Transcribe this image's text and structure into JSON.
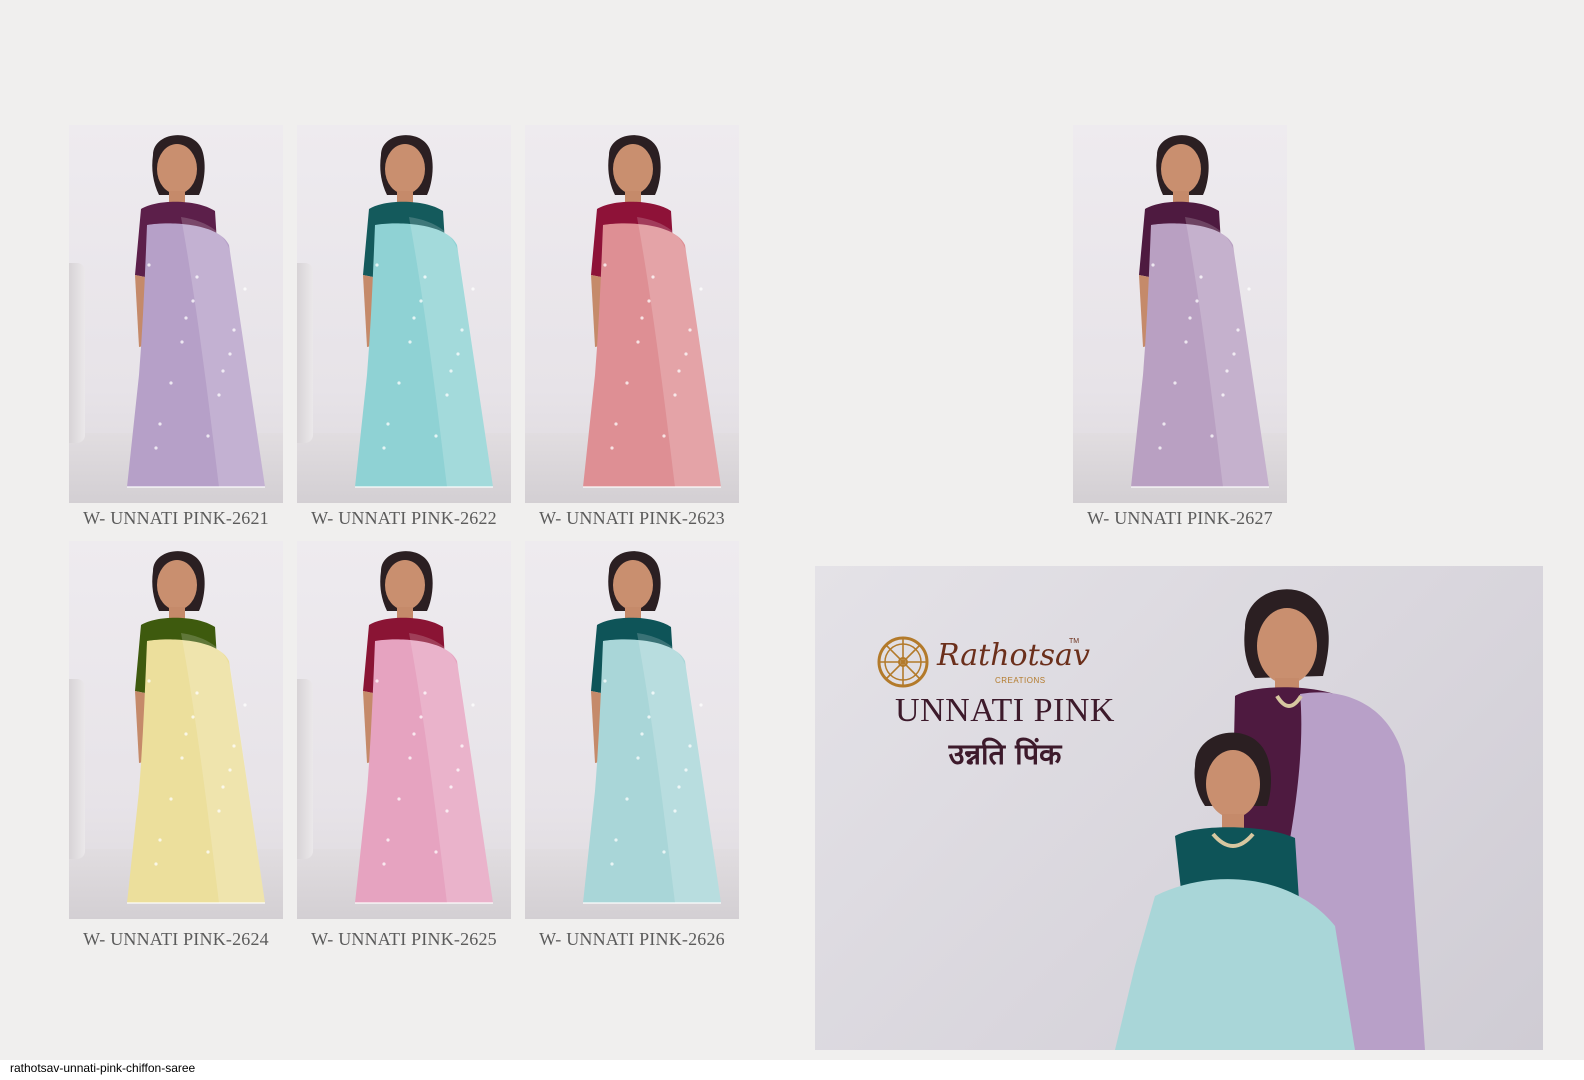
{
  "catalog": {
    "items": [
      {
        "code": "W- UNNATI PINK-2621",
        "saree_color": "#b6a0c8",
        "blouse_color": "#5c1f4a"
      },
      {
        "code": "W- UNNATI PINK-2622",
        "saree_color": "#8fd2d4",
        "blouse_color": "#145a5c"
      },
      {
        "code": "W- UNNATI PINK-2623",
        "saree_color": "#de8f94",
        "blouse_color": "#8e1238"
      },
      {
        "code": "W- UNNATI PINK-2627",
        "saree_color": "#b9a0c2",
        "blouse_color": "#4e1a40"
      },
      {
        "code": "W- UNNATI PINK-2624",
        "saree_color": "#ecdf9c",
        "blouse_color": "#3e5a0e"
      },
      {
        "code": "W- UNNATI PINK-2625",
        "saree_color": "#e6a3c0",
        "blouse_color": "#8a1434"
      },
      {
        "code": "W- UNNATI PINK-2626",
        "saree_color": "#a9d6d8",
        "blouse_color": "#0e5458"
      }
    ]
  },
  "banner": {
    "brand": "Rathotsav",
    "brand_tm": "TM",
    "brand_sub": "CREATIONS",
    "title": "UNNATI PINK",
    "subtitle": "उन्नति पिंक",
    "colors": {
      "brand": "#6b2f1b",
      "wheel": "#b37a2a",
      "title": "#3d1a2b"
    },
    "models": [
      {
        "saree_color": "#b8a0c8",
        "blouse_color": "#4e1a40"
      },
      {
        "saree_color": "#a9d6d8",
        "blouse_color": "#0e5458"
      }
    ]
  },
  "footer": {
    "filename": "rathotsav-unnati-pink-chiffon-saree"
  }
}
